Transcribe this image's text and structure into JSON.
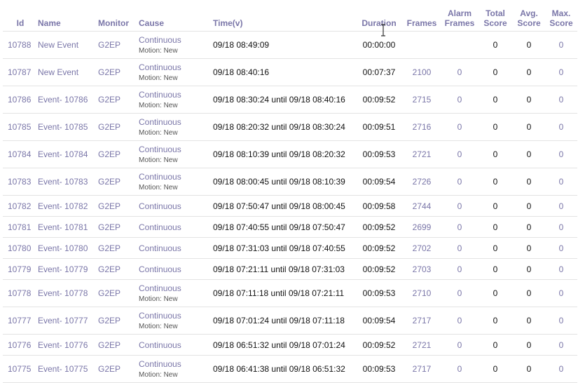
{
  "columns": {
    "id": "Id",
    "name": "Name",
    "monitor": "Monitor",
    "cause": "Cause",
    "time": "Time(v)",
    "duration": "Duration",
    "frames": "Frames",
    "alarm_frames_1": "Alarm",
    "alarm_frames_2": "Frames",
    "total_score_1": "Total",
    "total_score_2": "Score",
    "avg_score_1": "Avg.",
    "avg_score_2": "Score",
    "max_score_1": "Max.",
    "max_score_2": "Score"
  },
  "rows": [
    {
      "id": "10788",
      "name": "New Event",
      "monitor": "G2EP",
      "cause": "Continuous",
      "cause_note": "Motion: New",
      "time": "09/18 08:49:09",
      "duration": "00:00:00",
      "frames": "",
      "alarm_frames": "",
      "total_score": "0",
      "avg_score": "0",
      "max_score": "0"
    },
    {
      "id": "10787",
      "name": "New Event",
      "monitor": "G2EP",
      "cause": "Continuous",
      "cause_note": "Motion: New",
      "time": "09/18 08:40:16",
      "duration": "00:07:37",
      "frames": "2100",
      "alarm_frames": "0",
      "total_score": "0",
      "avg_score": "0",
      "max_score": "0"
    },
    {
      "id": "10786",
      "name": "Event- 10786",
      "monitor": "G2EP",
      "cause": "Continuous",
      "cause_note": "Motion: New",
      "time": "09/18 08:30:24 until 09/18 08:40:16",
      "duration": "00:09:52",
      "frames": "2715",
      "alarm_frames": "0",
      "total_score": "0",
      "avg_score": "0",
      "max_score": "0"
    },
    {
      "id": "10785",
      "name": "Event- 10785",
      "monitor": "G2EP",
      "cause": "Continuous",
      "cause_note": "Motion: New",
      "time": "09/18 08:20:32 until 09/18 08:30:24",
      "duration": "00:09:51",
      "frames": "2716",
      "alarm_frames": "0",
      "total_score": "0",
      "avg_score": "0",
      "max_score": "0"
    },
    {
      "id": "10784",
      "name": "Event- 10784",
      "monitor": "G2EP",
      "cause": "Continuous",
      "cause_note": "Motion: New",
      "time": "09/18 08:10:39 until 09/18 08:20:32",
      "duration": "00:09:53",
      "frames": "2721",
      "alarm_frames": "0",
      "total_score": "0",
      "avg_score": "0",
      "max_score": "0"
    },
    {
      "id": "10783",
      "name": "Event- 10783",
      "monitor": "G2EP",
      "cause": "Continuous",
      "cause_note": "Motion: New",
      "time": "09/18 08:00:45 until 09/18 08:10:39",
      "duration": "00:09:54",
      "frames": "2726",
      "alarm_frames": "0",
      "total_score": "0",
      "avg_score": "0",
      "max_score": "0"
    },
    {
      "id": "10782",
      "name": "Event- 10782",
      "monitor": "G2EP",
      "cause": "Continuous",
      "cause_note": "",
      "time": "09/18 07:50:47 until 09/18 08:00:45",
      "duration": "00:09:58",
      "frames": "2744",
      "alarm_frames": "0",
      "total_score": "0",
      "avg_score": "0",
      "max_score": "0"
    },
    {
      "id": "10781",
      "name": "Event- 10781",
      "monitor": "G2EP",
      "cause": "Continuous",
      "cause_note": "",
      "time": "09/18 07:40:55 until 09/18 07:50:47",
      "duration": "00:09:52",
      "frames": "2699",
      "alarm_frames": "0",
      "total_score": "0",
      "avg_score": "0",
      "max_score": "0"
    },
    {
      "id": "10780",
      "name": "Event- 10780",
      "monitor": "G2EP",
      "cause": "Continuous",
      "cause_note": "",
      "time": "09/18 07:31:03 until 09/18 07:40:55",
      "duration": "00:09:52",
      "frames": "2702",
      "alarm_frames": "0",
      "total_score": "0",
      "avg_score": "0",
      "max_score": "0"
    },
    {
      "id": "10779",
      "name": "Event- 10779",
      "monitor": "G2EP",
      "cause": "Continuous",
      "cause_note": "",
      "time": "09/18 07:21:11 until 09/18 07:31:03",
      "duration": "00:09:52",
      "frames": "2703",
      "alarm_frames": "0",
      "total_score": "0",
      "avg_score": "0",
      "max_score": "0"
    },
    {
      "id": "10778",
      "name": "Event- 10778",
      "monitor": "G2EP",
      "cause": "Continuous",
      "cause_note": "Motion: New",
      "time": "09/18 07:11:18 until 09/18 07:21:11",
      "duration": "00:09:53",
      "frames": "2710",
      "alarm_frames": "0",
      "total_score": "0",
      "avg_score": "0",
      "max_score": "0"
    },
    {
      "id": "10777",
      "name": "Event- 10777",
      "monitor": "G2EP",
      "cause": "Continuous",
      "cause_note": "Motion: New",
      "time": "09/18 07:01:24 until 09/18 07:11:18",
      "duration": "00:09:54",
      "frames": "2717",
      "alarm_frames": "0",
      "total_score": "0",
      "avg_score": "0",
      "max_score": "0"
    },
    {
      "id": "10776",
      "name": "Event- 10776",
      "monitor": "G2EP",
      "cause": "Continuous",
      "cause_note": "",
      "time": "09/18 06:51:32 until 09/18 07:01:24",
      "duration": "00:09:52",
      "frames": "2721",
      "alarm_frames": "0",
      "total_score": "0",
      "avg_score": "0",
      "max_score": "0"
    },
    {
      "id": "10775",
      "name": "Event- 10775",
      "monitor": "G2EP",
      "cause": "Continuous",
      "cause_note": "Motion: New",
      "time": "09/18 06:41:38 until 09/18 06:51:32",
      "duration": "00:09:53",
      "frames": "2717",
      "alarm_frames": "0",
      "total_score": "0",
      "avg_score": "0",
      "max_score": "0"
    }
  ],
  "cursor_icon": "text-cursor-icon"
}
